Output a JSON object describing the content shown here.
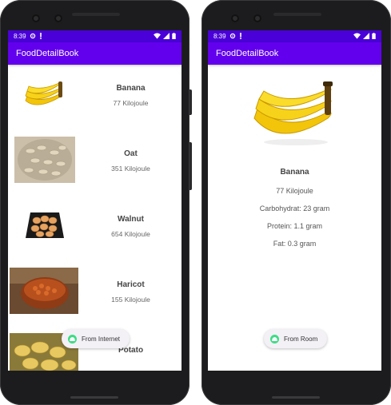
{
  "left_phone": {
    "status": {
      "time": "8:39"
    },
    "app_title": "FoodDetailBook",
    "foods": [
      {
        "name": "Banana",
        "energy": "77 Kilojoule",
        "image": "banana-image"
      },
      {
        "name": "Oat",
        "energy": "351 Kilojoule",
        "image": "oat-image"
      },
      {
        "name": "Walnut",
        "energy": "654 Kilojoule",
        "image": "walnut-image"
      },
      {
        "name": "Haricot",
        "energy": "155 Kilojoule",
        "image": "haricot-image"
      },
      {
        "name": "Potato",
        "energy": "",
        "image": "potato-image"
      }
    ],
    "fab_label": "From Internet"
  },
  "right_phone": {
    "status": {
      "time": "8:39"
    },
    "app_title": "FoodDetailBook",
    "detail": {
      "name": "Banana",
      "energy": "77 Kilojoule",
      "carbohydrate": "Carbohydrat: 23 gram",
      "protein": "Protein: 1.1 gram",
      "fat": "Fat: 0.3 gram",
      "image": "banana-image"
    },
    "fab_label": "From Room"
  },
  "colors": {
    "status_bar": "#4a00d8",
    "app_bar": "#6200ee",
    "fab_icon": "#3ddc84",
    "fab_background": "#f3f0f6"
  },
  "icons": {
    "status": [
      "gear-icon",
      "notification-icon",
      "wifi-icon",
      "signal-icon",
      "battery-icon"
    ],
    "fab": "android-icon"
  }
}
